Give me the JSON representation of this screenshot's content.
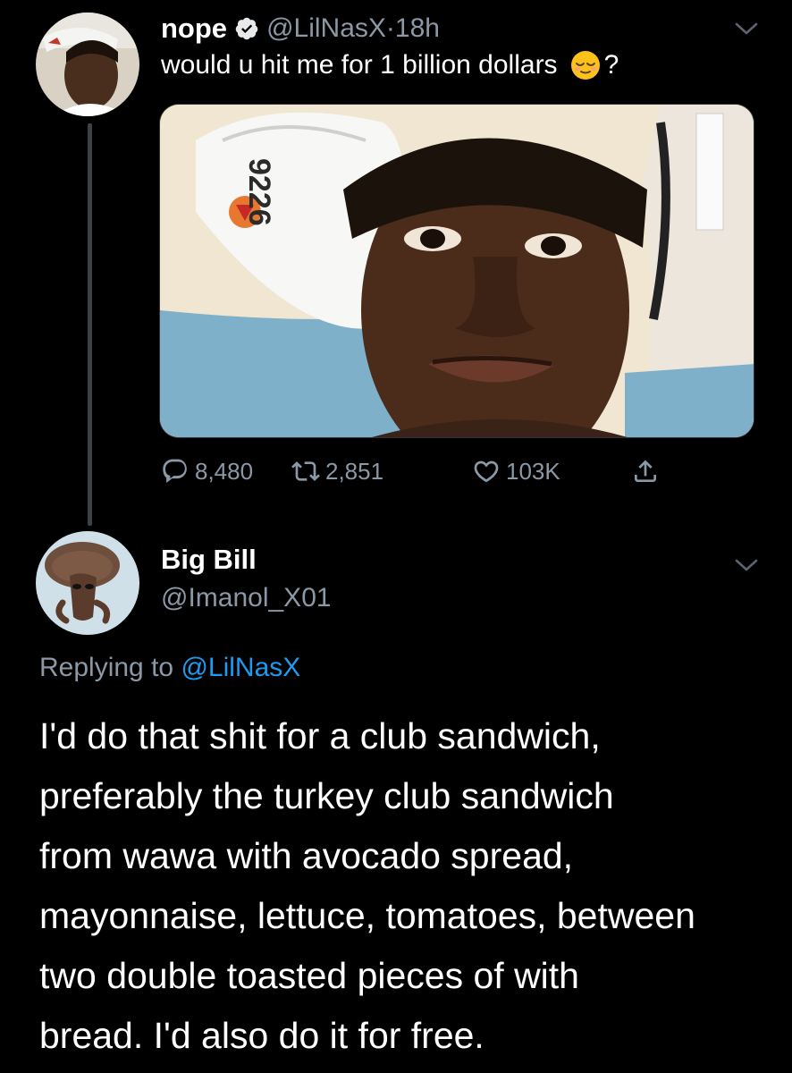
{
  "tweet": {
    "display_name": "nope",
    "handle": "@LilNasX",
    "separator": "·",
    "time": "18h",
    "text": "would u hit me for 1 billion dollars",
    "text_suffix": "?",
    "icons": {
      "verified": "verified-badge-icon",
      "emoji": "relieved-face-emoji",
      "menu": "chevron-down-icon"
    },
    "stats": {
      "replies": "8,480",
      "retweets": "2,851",
      "likes": "103K"
    }
  },
  "reply": {
    "display_name": "Big Bill",
    "handle": "@Imanol_X01",
    "replying_label": "Replying to",
    "replying_to": "@LilNasX",
    "lines": [
      "I'd do that shit for a club sandwich,",
      "preferably the turkey club sandwich",
      "from wawa with avocado spread,",
      "mayonnaise, lettuce, tomatoes, between",
      "two double toasted pieces of with",
      "bread. I'd also do it for free."
    ]
  },
  "colors": {
    "background": "#000000",
    "text": "#ffffff",
    "secondary_text": "#8b98a5",
    "accent": "#1d9bf0"
  }
}
